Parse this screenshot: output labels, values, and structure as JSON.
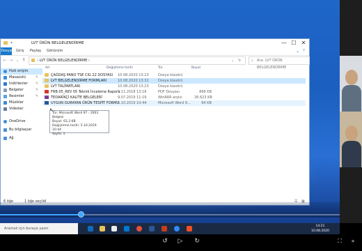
{
  "window": {
    "title": "LVT ÜRÜN BELGELENDİRME",
    "minimize_label": "—",
    "maximize_label": "☐",
    "close_label": "✕",
    "help_label": "?"
  },
  "ribbon": {
    "tabs": [
      "Dosya",
      "Giriş",
      "Paylaş",
      "Görünüm"
    ]
  },
  "address": {
    "path": "›  LVT ÜRÜN BELGELENDİRME  ›",
    "search_placeholder": "Ara: LVT ÜRÜN BELGELENDİRME"
  },
  "sidebar": {
    "items": [
      {
        "label": "Hızlı erişim",
        "icon": "star-icon",
        "pinned": false
      },
      {
        "label": "Masaüstü",
        "icon": "desktop-icon",
        "pinned": true
      },
      {
        "label": "İndirilenler",
        "icon": "download-icon",
        "pinned": true
      },
      {
        "label": "Belgeler",
        "icon": "document-icon",
        "pinned": true
      },
      {
        "label": "Resimler",
        "icon": "picture-icon",
        "pinned": true
      },
      {
        "label": "Müzikler",
        "icon": "music-icon",
        "pinned": false
      },
      {
        "label": "Videolar",
        "icon": "video-icon",
        "pinned": false
      },
      {
        "label": "OneDrive",
        "icon": "cloud-icon",
        "pinned": false
      },
      {
        "label": "Bu bilgisayar",
        "icon": "computer-icon",
        "pinned": false
      },
      {
        "label": "Ağ",
        "icon": "network-icon",
        "pinned": false
      }
    ]
  },
  "columns": {
    "name": "Ad",
    "date": "Değiştirme tarihi",
    "type": "Tür",
    "size": "Boyut"
  },
  "files": [
    {
      "name": "ÇAĞDAŞ PANO TSE CIG 22 DOSYASI",
      "date": "10.08.2020 13:23",
      "type": "Dosya klasörü",
      "size": "",
      "kind": "folder"
    },
    {
      "name": "LVT BELGELENDİRME FORMLARI",
      "date": "10.08.2020 13:32",
      "type": "Dosya klasörü",
      "size": "",
      "kind": "folder"
    },
    {
      "name": "LVT TALİMATLARI",
      "date": "10.08.2020 13:23",
      "type": "Dosya klasörü",
      "size": "",
      "kind": "folder"
    },
    {
      "name": "FRB.05_REV 05 Teknik İnceleme Raporu",
      "date": "9.11.2018 13:18",
      "type": "PDF Dosyası",
      "size": "866 KB",
      "kind": "pdf"
    },
    {
      "name": "TEDARİKÇİ KALİTE BELGELERİ",
      "date": "9.07.2019 11:19",
      "type": "WinRAR arşivi",
      "size": "26.623 KB",
      "kind": "rar"
    },
    {
      "name": "UYGUN OLMAYAN ÜRÜN TESPİT FORMU",
      "date": "5.10.2019 10:44",
      "type": "Microsoft Word 9...",
      "size": "64 KB",
      "kind": "word"
    }
  ],
  "tooltip": {
    "line1": "Tür: Microsoft Word 97 - 2003 Belgesi",
    "line2": "Boyut: 63,3 KB",
    "line3": "Değiştirme tarihi: 5.10.2019 10:44",
    "line4": "Sayfa: 1"
  },
  "status": {
    "count": "6 öğe",
    "selected": "1 öğe seçildi"
  },
  "taskbar": {
    "search_placeholder": "Aramak için buraya yazın",
    "time": "14:21",
    "date": "10.08.2020"
  },
  "colors": {
    "accent": "#3ea6ff",
    "selection": "#cce8ff",
    "folder": "#e8c25a"
  }
}
